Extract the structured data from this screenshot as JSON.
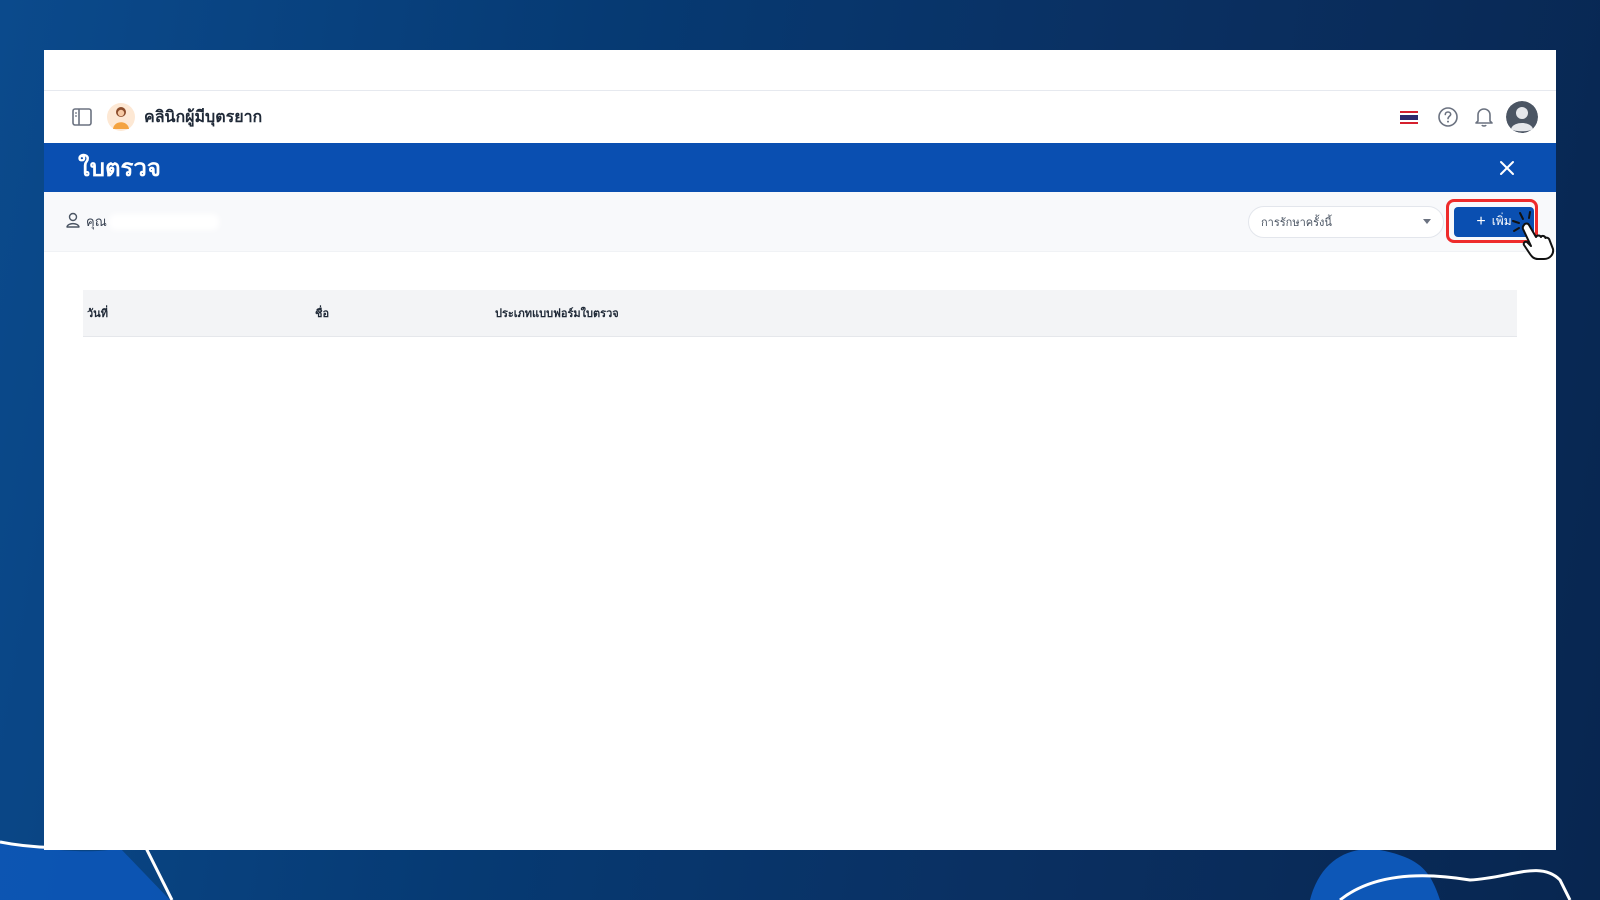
{
  "app": {
    "clinic_name": "คลินิกผู้มีบุตรยาก"
  },
  "modal": {
    "title": "ใบตรวจ"
  },
  "toolbar": {
    "patient_prefix": "คุณ",
    "filter": {
      "selected": "การรักษาครั้งนี้"
    },
    "add_label": "เพิ่ม"
  },
  "table": {
    "columns": [
      "วันที่",
      "ชื่อ",
      "ประเภทแบบฟอร์มใบตรวจ"
    ],
    "rows": []
  },
  "colors": {
    "primary": "#0a4fb1",
    "highlight": "#ee2b2b",
    "background": "#063a73"
  },
  "icons": {
    "sidebar_toggle": "sidebar-toggle-icon",
    "language": "thai-flag-icon",
    "help": "help-circle-icon",
    "notifications": "bell-icon",
    "close": "close-icon",
    "patient": "user-icon",
    "add": "plus-icon",
    "cursor": "hand-pointer-icon"
  }
}
